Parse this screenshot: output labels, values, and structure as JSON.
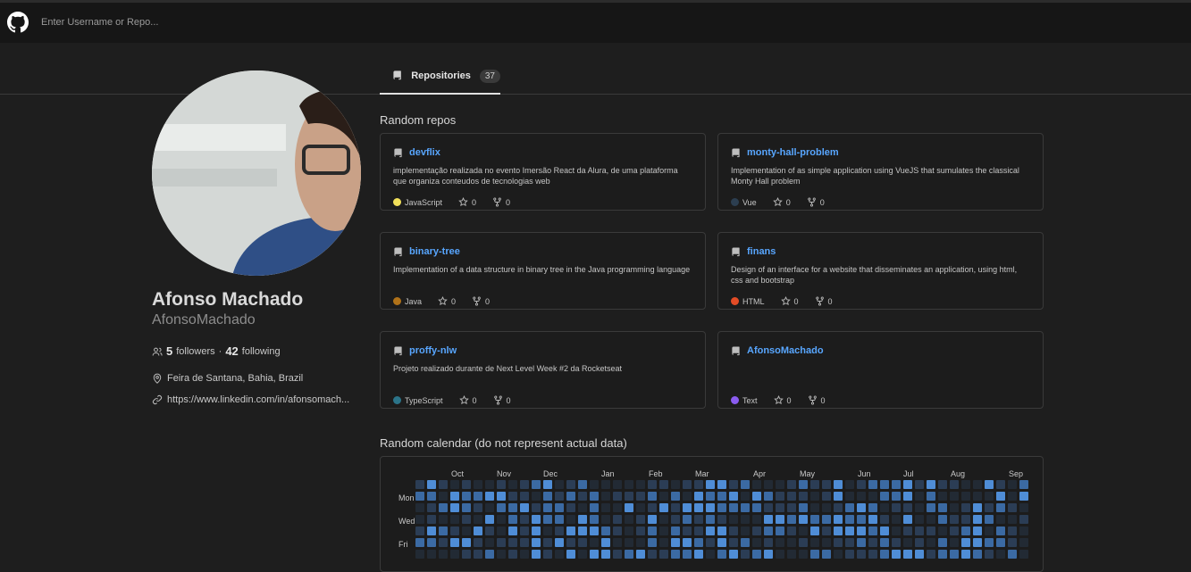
{
  "header": {
    "search_placeholder": "Enter Username or Repo...",
    "logo_icon": "github-mark-icon"
  },
  "tabs": [
    {
      "label": "Repositories",
      "count": "37",
      "icon": "repo-icon",
      "active": true
    }
  ],
  "profile": {
    "name": "Afonso Machado",
    "login": "AfonsoMachado",
    "followers_count": "5",
    "followers_label": "followers",
    "separator": "·",
    "following_count": "42",
    "following_label": "following",
    "location": "Feira de Santana, Bahia, Brazil",
    "website": "https://www.linkedin.com/in/afonsomach..."
  },
  "repos_section_title": "Random repos",
  "repos": [
    {
      "name": "devflix",
      "description": "implementação realizada no evento Imersão React da Alura, de uma plataforma que organiza conteudos de tecnologias web",
      "language": "JavaScript",
      "language_color": "#f1e05a",
      "stars": "0",
      "forks": "0"
    },
    {
      "name": "monty-hall-problem",
      "description": "Implementation of as simple application using VueJS that sumulates the classical Monty Hall problem",
      "language": "Vue",
      "language_color": "#2c3e50",
      "stars": "0",
      "forks": "0"
    },
    {
      "name": "binary-tree",
      "description": "Implementation of a data structure in binary tree in the Java programming language",
      "language": "Java",
      "language_color": "#b07219",
      "stars": "0",
      "forks": "0"
    },
    {
      "name": "finans",
      "description": "Design of an interface for a website that disseminates an application, using html, css and bootstrap",
      "language": "HTML",
      "language_color": "#e34c26",
      "stars": "0",
      "forks": "0"
    },
    {
      "name": "proffy-nlw",
      "description": "Projeto realizado durante de Next Level Week #2 da Rocketseat",
      "language": "TypeScript",
      "language_color": "#2b7489",
      "stars": "0",
      "forks": "0"
    },
    {
      "name": "AfonsoMachado",
      "description": "",
      "language": "Text",
      "language_color": "#8a5cf0",
      "stars": "0",
      "forks": "0"
    }
  ],
  "calendar_section_title": "Random calendar (do not represent actual data)",
  "calendar": {
    "months": [
      "Oct",
      "Nov",
      "Dec",
      "Jan",
      "Feb",
      "Mar",
      "Apr",
      "May",
      "Jun",
      "Jul",
      "Aug",
      "Sep"
    ],
    "day_labels": [
      "Mon",
      "Wed",
      "Fri"
    ],
    "level_colors": [
      "#222a34",
      "#2b3d55",
      "#3b6aa3",
      "#4f8dd6"
    ]
  }
}
